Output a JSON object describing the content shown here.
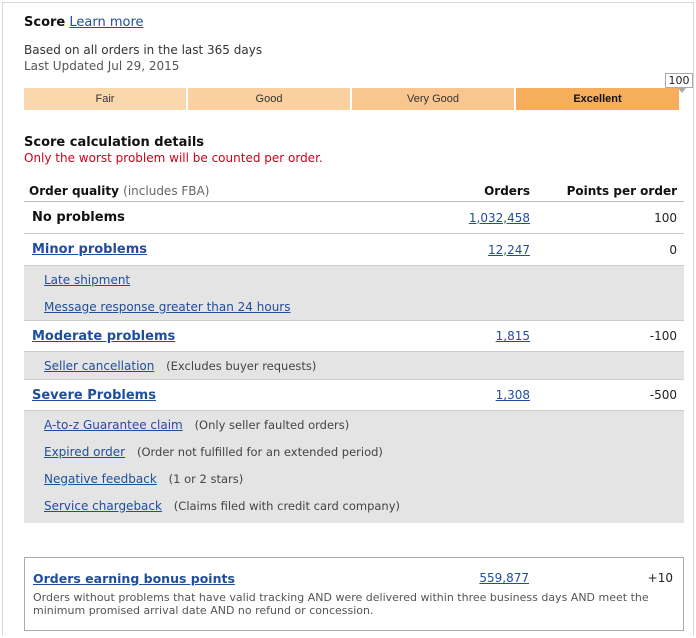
{
  "header": {
    "score_label": "Score",
    "learn_more": "Learn more",
    "based_on": "Based on all orders in the last 365 days",
    "last_updated": "Last Updated Jul 29, 2015"
  },
  "score_bar": {
    "segments": [
      "Fair",
      "Good",
      "Very Good",
      "Excellent"
    ],
    "current": "Excellent",
    "value": "100",
    "colors": [
      "#fbd7ae",
      "#fbd0a0",
      "#f9c690",
      "#f6ad5c"
    ]
  },
  "calculation": {
    "title": "Score calculation details",
    "note": "Only the worst problem will be counted per order.",
    "note_color": "#d0021b"
  },
  "table": {
    "headers": {
      "quality": "Order quality",
      "quality_sub": "(includes FBA)",
      "orders": "Orders",
      "points": "Points per order"
    },
    "no_problems": {
      "label": "No problems",
      "orders": "1,032,458",
      "points": "100"
    },
    "minor": {
      "label": "Minor problems",
      "orders": "12,247",
      "points": "0",
      "items": [
        {
          "label": "Late shipment",
          "note": ""
        },
        {
          "label": "Message response greater than 24 hours",
          "note": ""
        }
      ]
    },
    "moderate": {
      "label": "Moderate problems",
      "orders": "1,815",
      "points": "-100",
      "items": [
        {
          "label": "Seller cancellation",
          "note": "(Excludes buyer requests)"
        }
      ]
    },
    "severe": {
      "label": "Severe Problems",
      "orders": "1,308",
      "points": "-500",
      "items": [
        {
          "label": "A-to-z Guarantee claim",
          "note": "(Only seller faulted orders)"
        },
        {
          "label": "Expired order",
          "note": "(Order not fulfilled for an extended period)"
        },
        {
          "label": "Negative feedback",
          "note": "(1 or 2 stars)"
        },
        {
          "label": "Service chargeback",
          "note": "(Claims filed with credit card company)"
        }
      ]
    }
  },
  "bonus": {
    "label": "Orders earning bonus points",
    "orders": "559,877",
    "points": "+10",
    "description": "Orders without problems that have valid tracking AND were delivered within three business days AND meet the minimum promised arrival date AND no refund or concession."
  }
}
